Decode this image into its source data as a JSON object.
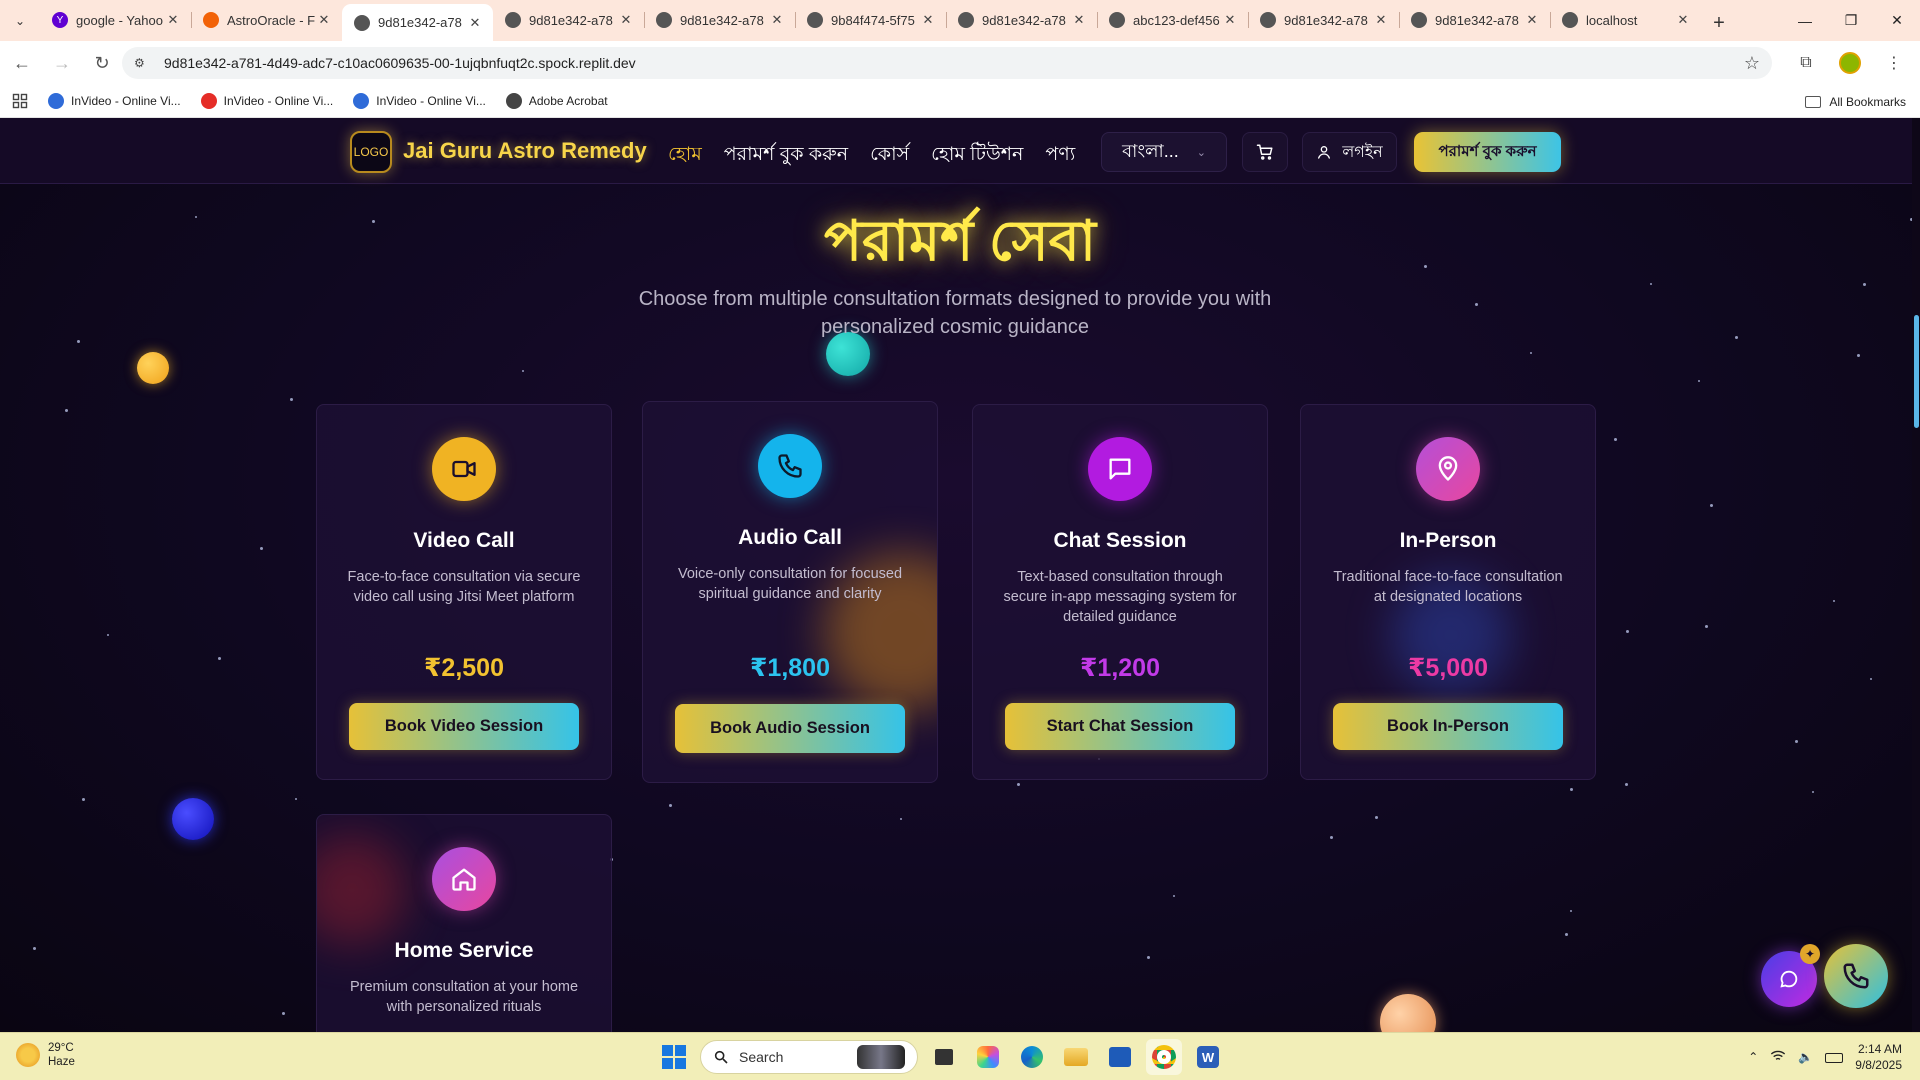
{
  "browser": {
    "tabs": [
      {
        "title": "google - Yahoo",
        "favicon_color": "#6001d2",
        "favicon_glyph": "Y",
        "active": false
      },
      {
        "title": "AstroOracle - F",
        "favicon_color": "#f26207",
        "favicon_glyph": "",
        "active": false
      },
      {
        "title": "9d81e342-a78",
        "favicon_color": "#555555",
        "favicon_glyph": "",
        "active": true
      },
      {
        "title": "9d81e342-a78",
        "favicon_color": "#555555",
        "favicon_glyph": "",
        "active": false
      },
      {
        "title": "9d81e342-a78",
        "favicon_color": "#555555",
        "favicon_glyph": "",
        "active": false
      },
      {
        "title": "9b84f474-5f75",
        "favicon_color": "#555555",
        "favicon_glyph": "",
        "active": false
      },
      {
        "title": "9d81e342-a78",
        "favicon_color": "#555555",
        "favicon_glyph": "",
        "active": false
      },
      {
        "title": "abc123-def456",
        "favicon_color": "#555555",
        "favicon_glyph": "",
        "active": false
      },
      {
        "title": "9d81e342-a78",
        "favicon_color": "#555555",
        "favicon_glyph": "",
        "active": false
      },
      {
        "title": "9d81e342-a78",
        "favicon_color": "#555555",
        "favicon_glyph": "",
        "active": false
      },
      {
        "title": "localhost",
        "favicon_color": "#555555",
        "favicon_glyph": "",
        "active": false
      }
    ],
    "url": "9d81e342-a781-4d49-adc7-c10ac0609635-00-1ujqbnfuqt2c.spock.replit.dev",
    "bookmarks": [
      {
        "label": "InVideo - Online Vi...",
        "icon_color": "#2f6bd8"
      },
      {
        "label": "InVideo - Online Vi...",
        "icon_color": "#e52d27"
      },
      {
        "label": "InVideo - Online Vi...",
        "icon_color": "#2f6bd8"
      },
      {
        "label": "Adobe Acrobat",
        "icon_color": "#444444"
      }
    ],
    "all_bookmarks_label": "All Bookmarks"
  },
  "site": {
    "logo_text": "LOGO",
    "brand": "Jai Guru Astro Remedy",
    "nav": [
      "হোম",
      "পরামর্শ বুক করুন",
      "কোর্স",
      "হোম টিউশন",
      "পণ্য"
    ],
    "language": "বাংলা...",
    "login": "লগইন",
    "cta": "পরামর্শ বুক করুন"
  },
  "section": {
    "title": "পরামর্শ সেবা",
    "subtitle": "Choose from multiple consultation formats designed to provide you with personalized cosmic guidance"
  },
  "services": [
    {
      "title": "Video Call",
      "description": "Face-to-face consultation via secure video call using Jitsi Meet platform",
      "price": "₹2,500",
      "button": "Book Video Session",
      "icon": "video-camera-icon",
      "icon_color": "#f0b323",
      "price_color": "#f2c230"
    },
    {
      "title": "Audio Call",
      "description": "Voice-only consultation for focused spiritual guidance and clarity",
      "price": "₹1,800",
      "button": "Book Audio Session",
      "icon": "phone-icon",
      "icon_color": "#14b4ec",
      "price_color": "#2cc3ef"
    },
    {
      "title": "Chat Session",
      "description": "Text-based consultation through secure in-app messaging system for detailed guidance",
      "price": "₹1,200",
      "button": "Start Chat Session",
      "icon": "chat-bubble-icon",
      "icon_color": "#b21be0",
      "price_color": "#c23ae8"
    },
    {
      "title": "In-Person",
      "description": "Traditional face-to-face consultation at designated locations",
      "price": "₹5,000",
      "button": "Book In-Person",
      "icon": "map-pin-icon",
      "icon_color": "#d04bc4",
      "price_color": "#ec3aa4"
    },
    {
      "title": "Home Service",
      "description": "Premium consultation at your home with personalized rituals",
      "price": "",
      "button": "",
      "icon": "home-icon",
      "icon_color": "#c946b8",
      "price_color": "#ec3aa4"
    }
  ],
  "taskbar": {
    "temperature": "29°C",
    "condition": "Haze",
    "search_placeholder": "Search",
    "time": "2:14 AM",
    "date": "9/8/2025"
  }
}
